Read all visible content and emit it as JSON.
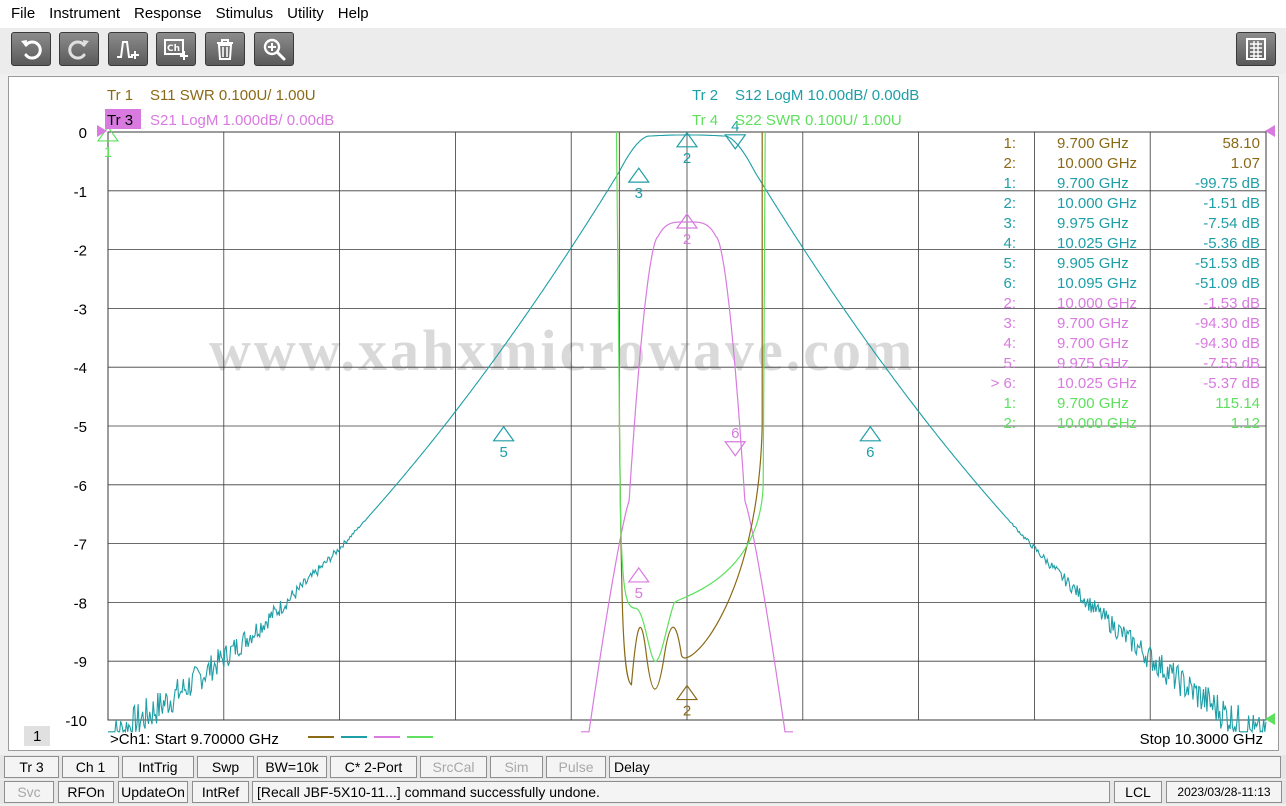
{
  "menu": [
    "File",
    "Instrument",
    "Response",
    "Stimulus",
    "Utility",
    "Help"
  ],
  "toolbar": {
    "buttons": [
      {
        "name": "undo-button",
        "icon": "undo-icon"
      },
      {
        "name": "redo-button",
        "icon": "redo-icon"
      },
      {
        "name": "add-marker-button",
        "icon": "marker-add-icon"
      },
      {
        "name": "add-channel-button",
        "icon": "channel-add-icon"
      },
      {
        "name": "delete-button",
        "icon": "trash-icon"
      },
      {
        "name": "zoom-button",
        "icon": "magnifier-icon"
      }
    ],
    "menu_button": {
      "name": "softkey-menu-button",
      "icon": "keypad-icon"
    }
  },
  "colors": {
    "tr1": "#8a6a16",
    "tr2": "#1e9ea6",
    "tr3": "#d87ae0",
    "tr4": "#5ee05e",
    "grid": "#3a3a3a",
    "tr3_highlight_bg": "#d87ae0"
  },
  "traces": {
    "tr1": {
      "id": "Tr 1",
      "text": "S11 SWR 0.100U/  1.00U"
    },
    "tr2": {
      "id": "Tr 2",
      "text": "S12 LogM 10.00dB/  0.00dB"
    },
    "tr3": {
      "id": "Tr 3",
      "text": "S21 LogM 1.000dB/  0.00dB"
    },
    "tr4": {
      "id": "Tr 4",
      "text": "S22 SWR 0.100U/  1.00U"
    }
  },
  "y_axis_labels": [
    "0",
    "-1",
    "-2",
    "-3",
    "-4",
    "-5",
    "-6",
    "-7",
    "-8",
    "-9",
    "-10"
  ],
  "marker_table": [
    {
      "n": "1:",
      "freq": "9.700  GHz",
      "val": "58.10",
      "trace": "tr1"
    },
    {
      "n": "2:",
      "freq": "10.000  GHz",
      "val": "1.07",
      "trace": "tr1"
    },
    {
      "n": "1:",
      "freq": "9.700  GHz",
      "val": "-99.75 dB",
      "trace": "tr2"
    },
    {
      "n": "2:",
      "freq": "10.000  GHz",
      "val": "-1.51 dB",
      "trace": "tr2"
    },
    {
      "n": "3:",
      "freq": "9.975  GHz",
      "val": "-7.54 dB",
      "trace": "tr2"
    },
    {
      "n": "4:",
      "freq": "10.025  GHz",
      "val": "-5.36 dB",
      "trace": "tr2"
    },
    {
      "n": "5:",
      "freq": "9.905  GHz",
      "val": "-51.53 dB",
      "trace": "tr2"
    },
    {
      "n": "6:",
      "freq": "10.095  GHz",
      "val": "-51.09 dB",
      "trace": "tr2"
    },
    {
      "n": "2:",
      "freq": "10.000  GHz",
      "val": "-1.53 dB",
      "trace": "tr3"
    },
    {
      "n": "3:",
      "freq": "9.700  GHz",
      "val": "-94.30 dB",
      "trace": "tr3"
    },
    {
      "n": "4:",
      "freq": "9.700  GHz",
      "val": "-94.30 dB",
      "trace": "tr3"
    },
    {
      "n": "5:",
      "freq": "9.975  GHz",
      "val": "-7.55 dB",
      "trace": "tr3"
    },
    {
      "n": "> 6:",
      "freq": "10.025  GHz",
      "val": "-5.37 dB",
      "trace": "tr3"
    },
    {
      "n": "1:",
      "freq": "9.700  GHz",
      "val": "115.14",
      "trace": "tr4"
    },
    {
      "n": "2:",
      "freq": "10.000  GHz",
      "val": "1.12",
      "trace": "tr4"
    }
  ],
  "markers": {
    "tr2": [
      {
        "label": "2",
        "x_ghz": 10.0,
        "y": -0.15,
        "dir": "up"
      },
      {
        "label": "3",
        "x_ghz": 9.975,
        "y": -0.75,
        "dir": "up"
      },
      {
        "label": "4",
        "x_ghz": 10.025,
        "y": -0.15,
        "dir": "down"
      },
      {
        "label": "5",
        "x_ghz": 9.905,
        "y": -5.15,
        "dir": "up"
      },
      {
        "label": "6",
        "x_ghz": 10.095,
        "y": -5.15,
        "dir": "up"
      }
    ],
    "tr3": [
      {
        "label": "2",
        "x_ghz": 10.0,
        "y": -1.53,
        "dir": "up"
      },
      {
        "label": "5",
        "x_ghz": 9.975,
        "y": -7.55,
        "dir": "up"
      },
      {
        "label": "6",
        "x_ghz": 10.025,
        "y": -5.37,
        "dir": "down"
      }
    ],
    "tr1": [
      {
        "label": "2",
        "x_ghz": 10.0,
        "y": -9.55,
        "dir": "up"
      }
    ],
    "tr4": [
      {
        "label": "1",
        "x_ghz": 9.7,
        "y": -0.05,
        "dir": "up"
      }
    ]
  },
  "watermark": "www.xahxmicrowave.com",
  "channel": {
    "number": "1",
    "start_label": ">Ch1:  Start  9.70000 GHz",
    "stop_label": "Stop  10.3000 GHz",
    "start_ghz": 9.7,
    "stop_ghz": 10.3
  },
  "softkeys": [
    {
      "label": "Tr 3",
      "enabled": true
    },
    {
      "label": "Ch 1",
      "enabled": true
    },
    {
      "label": "IntTrig",
      "enabled": true
    },
    {
      "label": "Swp",
      "enabled": true
    },
    {
      "label": "BW=10k",
      "enabled": true
    },
    {
      "label": "C* 2-Port",
      "enabled": true
    },
    {
      "label": "SrcCal",
      "enabled": false
    },
    {
      "label": "Sim",
      "enabled": false
    },
    {
      "label": "Pulse",
      "enabled": false
    },
    {
      "label": "Delay",
      "enabled": true
    }
  ],
  "status": {
    "items": [
      {
        "label": "Svc",
        "enabled": false
      },
      {
        "label": "RFOn",
        "enabled": true
      },
      {
        "label": "UpdateOn",
        "enabled": true
      },
      {
        "label": "IntRef",
        "enabled": true
      }
    ],
    "message": "[Recall JBF-5X10-11...] command successfully undone.",
    "lcl": "LCL",
    "datetime": "2023/03/28-11:13"
  }
}
